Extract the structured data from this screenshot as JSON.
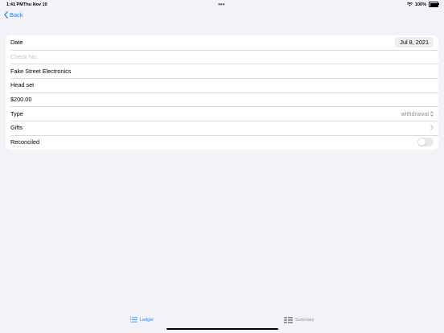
{
  "status_bar": {
    "time": "1:41 PM",
    "date": "Thu Nov 10",
    "battery": "100%"
  },
  "nav": {
    "back_label": "Back"
  },
  "form": {
    "date_label": "Date",
    "date_value": "Jul 8, 2021",
    "check_no_placeholder": "Check No.",
    "payee": "Fake Street Electronics",
    "memo": "Head set",
    "amount": "$200.00",
    "type_label": "Type",
    "type_value": "withdrawal",
    "gifts_label": "Gifts",
    "reconciled_label": "Reconciled",
    "reconciled": false
  },
  "tabs": [
    {
      "label": "Ledger",
      "selected": true
    },
    {
      "label": "Summary",
      "selected": false
    }
  ],
  "colors": {
    "accent": "#0a84ff",
    "background": "#f2f2f7",
    "secondary_text": "#8e8e93"
  }
}
